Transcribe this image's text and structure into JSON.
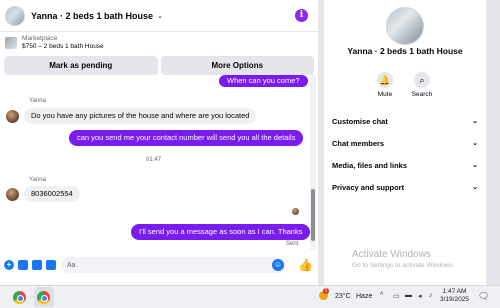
{
  "header": {
    "title": "Yanna · 2 beds 1 bath House"
  },
  "marketplace": {
    "label": "Marketplace",
    "listing": "$750 – 2 beds 1 bath House"
  },
  "actions": {
    "pending_label": "Mark as pending",
    "more_label": "More Options"
  },
  "messages": {
    "m1": "When can you come?",
    "sender1": "Yanna",
    "m2": "Do you have any pictures of the house and where are you located",
    "m3": "can you send me your contact number will send you all the details",
    "time": "01:47",
    "sender2": "Yanna",
    "m4": "8036002554",
    "m5": "I'll send you a message as soon as I can. Thanks",
    "status": "Sent"
  },
  "composer": {
    "placeholder": "Aa"
  },
  "right_panel": {
    "title": "Yanna · 2 beds 1 bath House",
    "mute_label": "Mute",
    "search_label": "Search",
    "menu": [
      "Customise chat",
      "Chat members",
      "Media, files and links",
      "Privacy and support"
    ],
    "watermark_title": "Activate Windows",
    "watermark_sub": "Go to Settings to activate Windows."
  },
  "taskbar": {
    "temperature": "23°C",
    "weather": "Haze",
    "time": "1:47 AM",
    "date": "3/19/2025",
    "badge": "1"
  },
  "icons": [
    "info-icon",
    "plus-icon",
    "sticker-icon",
    "gif-icon",
    "image-icon",
    "emoji-icon",
    "like-icon",
    "bell-icon",
    "search-icon",
    "chrome-icon"
  ],
  "colors": {
    "outgoing_bubble": "#7a1cf0",
    "incoming_bubble": "#f0f0f0",
    "accent": "#1877f2"
  }
}
